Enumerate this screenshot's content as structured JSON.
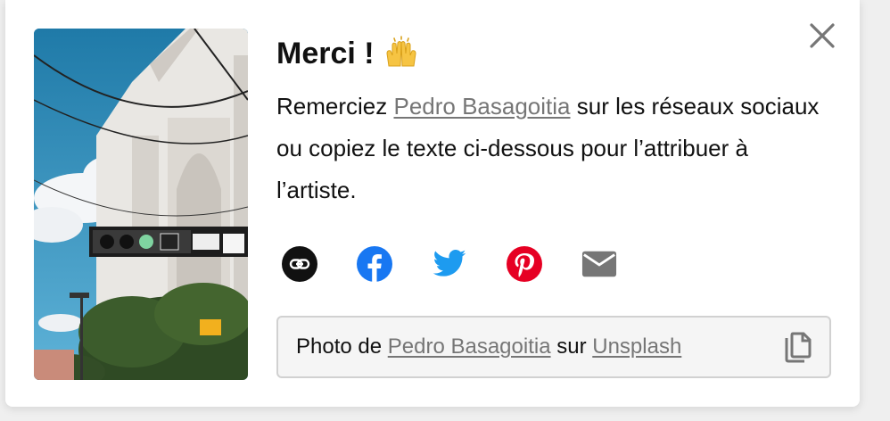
{
  "dialog": {
    "title": "Merci !",
    "title_emoji": "raising-hands-emoji",
    "desc_before": "Remerciez ",
    "photographer": "Pedro Basagoitia",
    "desc_after": " sur les réseaux sociaux ou copiez le texte ci-dessous pour l’attribuer à l’artiste.",
    "close_icon": "close-icon"
  },
  "share": [
    {
      "name": "link",
      "icon": "link-icon",
      "color": "#111111"
    },
    {
      "name": "facebook",
      "icon": "facebook-icon",
      "color": "#1877f2"
    },
    {
      "name": "twitter",
      "icon": "twitter-icon",
      "color": "#1d9bf0"
    },
    {
      "name": "pinterest",
      "icon": "pinterest-icon",
      "color": "#e60023"
    },
    {
      "name": "email",
      "icon": "email-icon",
      "color": "#767676"
    }
  ],
  "attribution": {
    "prefix": "Photo de ",
    "photographer": "Pedro Basagoitia",
    "middle": " sur ",
    "site": "Unsplash",
    "copy_icon": "copy-icon"
  }
}
